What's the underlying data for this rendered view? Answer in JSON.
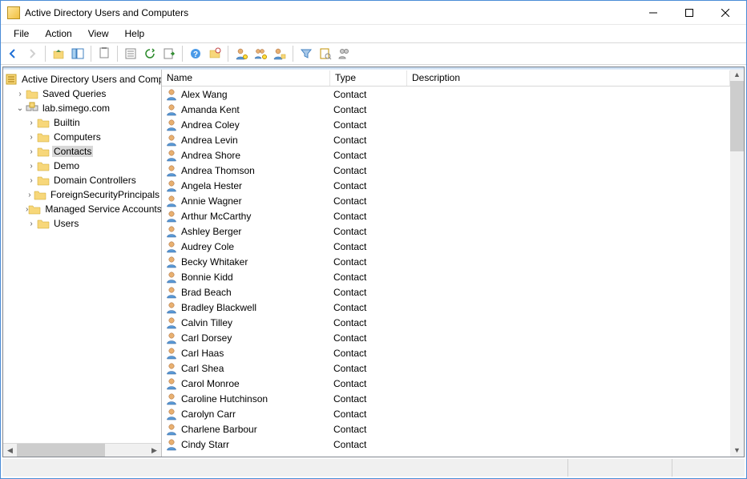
{
  "title": "Active Directory Users and Computers",
  "menu": [
    "File",
    "Action",
    "View",
    "Help"
  ],
  "toolbar_icons": [
    "back",
    "forward",
    "up",
    "show-hide-tree",
    "cut",
    "paste",
    "properties",
    "delete",
    "refresh",
    "export-list",
    "help",
    "new-user",
    "new-group",
    "add-to-group",
    "filter",
    "find",
    "advanced"
  ],
  "tree": {
    "root": "Active Directory Users and Computers",
    "nodes": [
      {
        "label": "Saved Queries",
        "icon": "folder",
        "expand": ">",
        "indent": 1
      },
      {
        "label": "lab.simego.com",
        "icon": "domain",
        "expand": "v",
        "indent": 1
      },
      {
        "label": "Builtin",
        "icon": "folder",
        "expand": ">",
        "indent": 2
      },
      {
        "label": "Computers",
        "icon": "folder",
        "expand": ">",
        "indent": 2
      },
      {
        "label": "Contacts",
        "icon": "folder",
        "expand": ">",
        "indent": 2,
        "selected": true
      },
      {
        "label": "Demo",
        "icon": "folder",
        "expand": ">",
        "indent": 2
      },
      {
        "label": "Domain Controllers",
        "icon": "folder",
        "expand": ">",
        "indent": 2
      },
      {
        "label": "ForeignSecurityPrincipals",
        "icon": "folder",
        "expand": ">",
        "indent": 2
      },
      {
        "label": "Managed Service Accounts",
        "icon": "folder",
        "expand": ">",
        "indent": 2
      },
      {
        "label": "Users",
        "icon": "folder",
        "expand": ">",
        "indent": 2
      }
    ]
  },
  "columns": {
    "name": "Name",
    "type": "Type",
    "description": "Description"
  },
  "rows": [
    {
      "name": "Alex Wang",
      "type": "Contact"
    },
    {
      "name": "Amanda Kent",
      "type": "Contact"
    },
    {
      "name": "Andrea Coley",
      "type": "Contact"
    },
    {
      "name": "Andrea Levin",
      "type": "Contact"
    },
    {
      "name": "Andrea Shore",
      "type": "Contact"
    },
    {
      "name": "Andrea Thomson",
      "type": "Contact"
    },
    {
      "name": "Angela Hester",
      "type": "Contact"
    },
    {
      "name": "Annie Wagner",
      "type": "Contact"
    },
    {
      "name": "Arthur McCarthy",
      "type": "Contact"
    },
    {
      "name": "Ashley Berger",
      "type": "Contact"
    },
    {
      "name": "Audrey Cole",
      "type": "Contact"
    },
    {
      "name": "Becky Whitaker",
      "type": "Contact"
    },
    {
      "name": "Bonnie Kidd",
      "type": "Contact"
    },
    {
      "name": "Brad Beach",
      "type": "Contact"
    },
    {
      "name": "Bradley Blackwell",
      "type": "Contact"
    },
    {
      "name": "Calvin Tilley",
      "type": "Contact"
    },
    {
      "name": "Carl Dorsey",
      "type": "Contact"
    },
    {
      "name": "Carl Haas",
      "type": "Contact"
    },
    {
      "name": "Carl Shea",
      "type": "Contact"
    },
    {
      "name": "Carol Monroe",
      "type": "Contact"
    },
    {
      "name": "Caroline Hutchinson",
      "type": "Contact"
    },
    {
      "name": "Carolyn Carr",
      "type": "Contact"
    },
    {
      "name": "Charlene Barbour",
      "type": "Contact"
    },
    {
      "name": "Cindy Starr",
      "type": "Contact"
    }
  ]
}
